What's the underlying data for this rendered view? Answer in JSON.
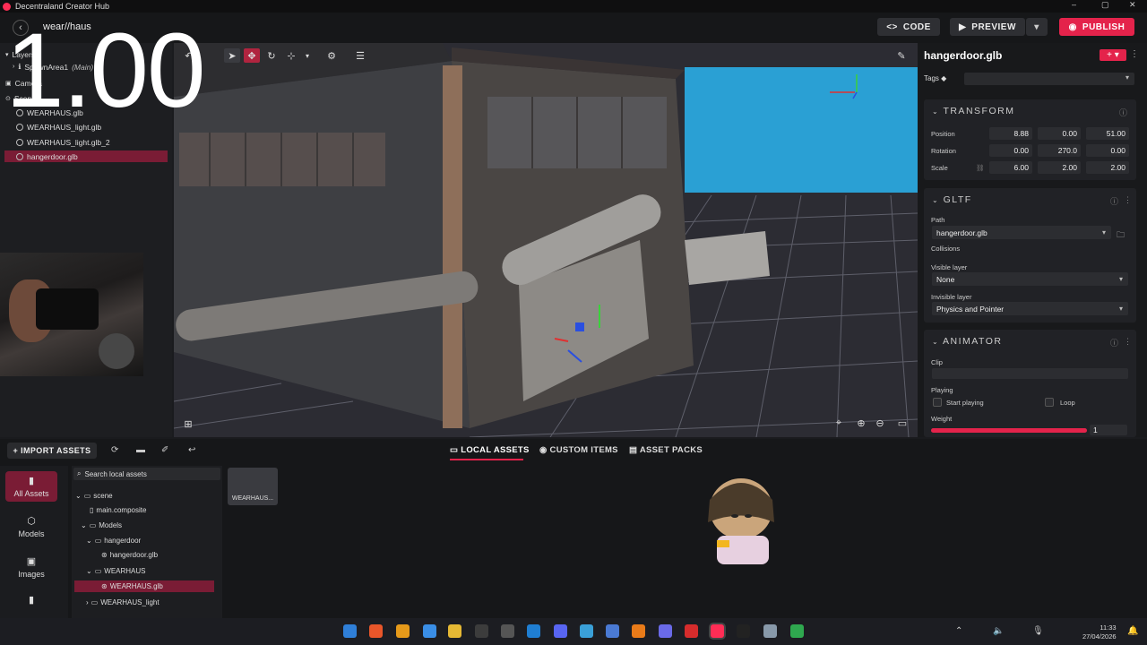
{
  "titlebar": {
    "title": "Decentraland Creator Hub",
    "minimize": "–",
    "maximize": "▢",
    "close": "✕"
  },
  "header": {
    "back_glyph": "‹",
    "scene_title": "wear//haus",
    "code_label": "CODE",
    "code_glyph": "<>",
    "preview_label": "PREVIEW",
    "preview_glyph": "▶",
    "preview_dd_glyph": "▾",
    "publish_label": "PUBLISH",
    "publish_glyph": "◉"
  },
  "overlay": {
    "time": "1.00"
  },
  "entity_tree": {
    "layers_label": "Layers",
    "spawn_area": "SpawnArea1",
    "spawn_main": "(Main)",
    "camera": "Camera",
    "scene": "Scene",
    "items": [
      "WEARHAUS.glb",
      "WEARHAUS_light.glb",
      "WEARHAUS_light.glb_2",
      "hangerdoor.glb"
    ],
    "selected_index": 3
  },
  "inspector": {
    "entity_name": "hangerdoor.glb",
    "add_glyph": "+ ▾",
    "kebab": "⋮",
    "tags_label": "Tags",
    "transform": {
      "title": "TRANSFORM",
      "position_label": "Position",
      "rotation_label": "Rotation",
      "scale_label": "Scale",
      "position": {
        "x": "8.88",
        "y": "0.00",
        "z": "51.00"
      },
      "rotation": {
        "x": "0.00",
        "y": "270.0",
        "z": "0.00"
      },
      "scale": {
        "x": "6.00",
        "y": "2.00",
        "z": "2.00"
      }
    },
    "gltf": {
      "title": "GLTF",
      "path_label": "Path",
      "path_value": "hangerdoor.glb",
      "collisions_label": "Collisions",
      "visible_layer_label": "Visible layer",
      "visible_layer_value": "None",
      "invisible_layer_label": "Invisible layer",
      "invisible_layer_value": "Physics and Pointer"
    },
    "animator": {
      "title": "ANIMATOR",
      "clip_label": "Clip",
      "playing_label": "Playing",
      "start_playing_label": "Start playing",
      "loop_label": "Loop",
      "weight_label": "Weight",
      "weight_value": "1",
      "weight_fraction": 1.0
    },
    "accent_color": "#e4234b"
  },
  "bottom": {
    "import_label": "+ IMPORT ASSETS",
    "tabs": [
      "LOCAL ASSETS",
      "CUSTOM ITEMS",
      "ASSET PACKS"
    ],
    "active_tab": 0,
    "categories": [
      {
        "label": "All Assets",
        "icon": "file-icon"
      },
      {
        "label": "Models",
        "icon": "cube-icon"
      },
      {
        "label": "Images",
        "icon": "image-icon"
      }
    ],
    "search_placeholder": "Search local assets",
    "asset_tree": [
      "scene",
      "main.composite",
      "Models",
      "hangerdoor",
      "hangerdoor.glb",
      "WEARHAUS",
      "WEARHAUS.glb",
      "WEARHAUS_light"
    ],
    "selected_asset": "WEARHAUS.glb",
    "grid_item_label": "WEARHAUS..."
  },
  "taskbar": {
    "time": "11:33",
    "date": "27/04/2026"
  }
}
